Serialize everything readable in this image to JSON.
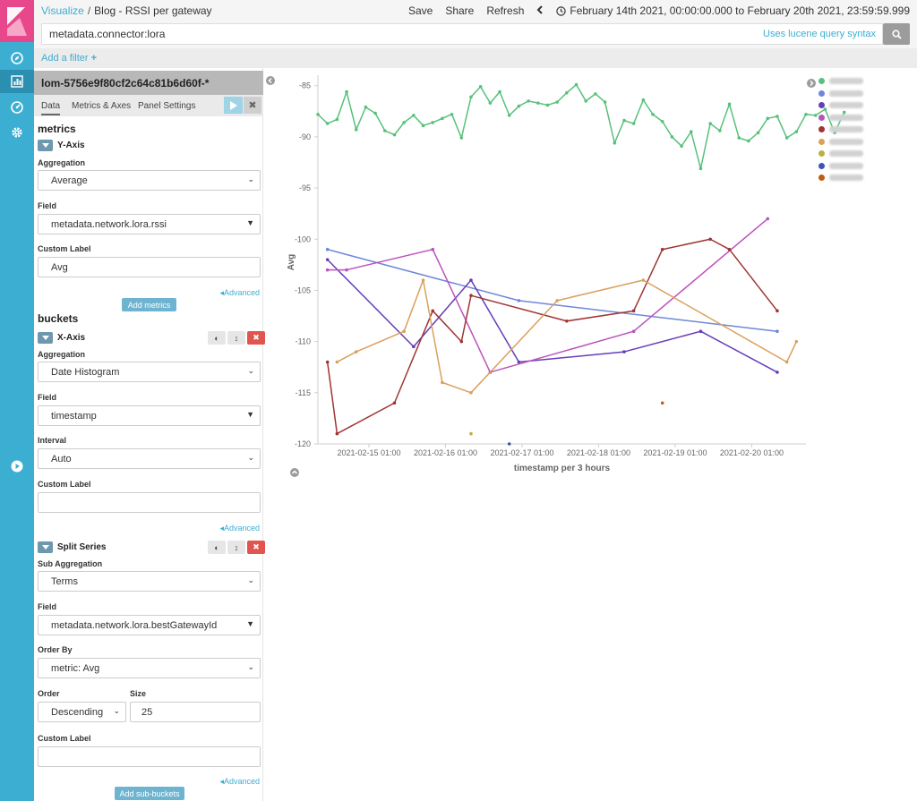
{
  "breadcrumb": {
    "root": "Visualize",
    "separator": "/",
    "current": "Blog - RSSI per gateway"
  },
  "topmenu": {
    "save": "Save",
    "share": "Share",
    "refresh": "Refresh",
    "time_range": "February 14th 2021, 00:00:00.000 to February 20th 2021, 23:59:59.999"
  },
  "query": {
    "value": "metadata.connector:lora",
    "syntax_link": "Uses lucene query syntax"
  },
  "filters": {
    "add_label": "Add a filter"
  },
  "editor": {
    "index_pattern": "lom-5756e9f80cf2c64c81b6d60f-*",
    "tabs": [
      "Data",
      "Metrics & Axes",
      "Panel Settings"
    ],
    "metrics_title": "metrics",
    "y_axis": {
      "title": "Y-Axis",
      "aggregation_label": "Aggregation",
      "aggregation": "Average",
      "field_label": "Field",
      "field": "metadata.network.lora.rssi",
      "custom_label_label": "Custom Label",
      "custom_label": "Avg",
      "advanced": "Advanced"
    },
    "add_metrics": "Add metrics",
    "buckets_title": "buckets",
    "x_axis": {
      "title": "X-Axis",
      "aggregation_label": "Aggregation",
      "aggregation": "Date Histogram",
      "field_label": "Field",
      "field": "timestamp",
      "interval_label": "Interval",
      "interval": "Auto",
      "custom_label_label": "Custom Label",
      "custom_label": "",
      "advanced": "Advanced"
    },
    "split_series": {
      "title": "Split Series",
      "sub_agg_label": "Sub Aggregation",
      "sub_agg": "Terms",
      "field_label": "Field",
      "field": "metadata.network.lora.bestGatewayId",
      "order_by_label": "Order By",
      "order_by": "metric: Avg",
      "order_label": "Order",
      "order": "Descending",
      "size_label": "Size",
      "size": "25",
      "custom_label_label": "Custom Label",
      "custom_label": "",
      "advanced": "Advanced"
    },
    "add_sub_buckets": "Add sub-buckets"
  },
  "chart_data": {
    "type": "line",
    "xlabel": "timestamp per 3 hours",
    "ylabel": "Avg",
    "xlim": [
      "2021-02-14T09:00",
      "2021-02-20T18:00"
    ],
    "ylim": [
      -120,
      -84.5
    ],
    "yticks": [
      -85,
      -90,
      -95,
      -100,
      -105,
      -110,
      -115,
      -120
    ],
    "xticks": [
      "2021-02-15 01:00",
      "2021-02-16 01:00",
      "2021-02-17 01:00",
      "2021-02-18 01:00",
      "2021-02-19 01:00",
      "2021-02-20 01:00"
    ],
    "series": [
      {
        "color": "#57c17b",
        "points": [
          [
            "2021-02-14T09:00",
            -87.8
          ],
          [
            "2021-02-14T12:00",
            -88.7
          ],
          [
            "2021-02-14T15:00",
            -88.3
          ],
          [
            "2021-02-14T18:00",
            -85.6
          ],
          [
            "2021-02-14T21:00",
            -89.3
          ],
          [
            "2021-02-15T00:00",
            -87.1
          ],
          [
            "2021-02-15T03:00",
            -87.7
          ],
          [
            "2021-02-15T06:00",
            -89.4
          ],
          [
            "2021-02-15T09:00",
            -89.8
          ],
          [
            "2021-02-15T12:00",
            -88.6
          ],
          [
            "2021-02-15T15:00",
            -87.9
          ],
          [
            "2021-02-15T18:00",
            -88.9
          ],
          [
            "2021-02-15T21:00",
            -88.6
          ],
          [
            "2021-02-16T00:00",
            -88.2
          ],
          [
            "2021-02-16T03:00",
            -87.8
          ],
          [
            "2021-02-16T06:00",
            -90.1
          ],
          [
            "2021-02-16T09:00",
            -86.1
          ],
          [
            "2021-02-16T12:00",
            -85.1
          ],
          [
            "2021-02-16T15:00",
            -86.7
          ],
          [
            "2021-02-16T18:00",
            -85.6
          ],
          [
            "2021-02-16T21:00",
            -87.9
          ],
          [
            "2021-02-17T00:00",
            -87.0
          ],
          [
            "2021-02-17T03:00",
            -86.5
          ],
          [
            "2021-02-17T06:00",
            -86.7
          ],
          [
            "2021-02-17T09:00",
            -86.9
          ],
          [
            "2021-02-17T12:00",
            -86.6
          ],
          [
            "2021-02-17T15:00",
            -85.7
          ],
          [
            "2021-02-17T18:00",
            -84.9
          ],
          [
            "2021-02-17T21:00",
            -86.5
          ],
          [
            "2021-02-18T00:00",
            -85.8
          ],
          [
            "2021-02-18T03:00",
            -86.6
          ],
          [
            "2021-02-18T06:00",
            -90.6
          ],
          [
            "2021-02-18T09:00",
            -88.4
          ],
          [
            "2021-02-18T12:00",
            -88.7
          ],
          [
            "2021-02-18T15:00",
            -86.4
          ],
          [
            "2021-02-18T18:00",
            -87.8
          ],
          [
            "2021-02-18T21:00",
            -88.5
          ],
          [
            "2021-02-19T00:00",
            -90.0
          ],
          [
            "2021-02-19T03:00",
            -90.9
          ],
          [
            "2021-02-19T06:00",
            -89.5
          ],
          [
            "2021-02-19T09:00",
            -93.1
          ],
          [
            "2021-02-19T12:00",
            -88.7
          ],
          [
            "2021-02-19T15:00",
            -89.4
          ],
          [
            "2021-02-19T18:00",
            -86.8
          ],
          [
            "2021-02-19T21:00",
            -90.1
          ],
          [
            "2021-02-20T00:00",
            -90.4
          ],
          [
            "2021-02-20T03:00",
            -89.6
          ],
          [
            "2021-02-20T06:00",
            -88.2
          ],
          [
            "2021-02-20T09:00",
            -88.0
          ],
          [
            "2021-02-20T12:00",
            -90.1
          ],
          [
            "2021-02-20T15:00",
            -89.5
          ],
          [
            "2021-02-20T18:00",
            -87.8
          ],
          [
            "2021-02-20T21:00",
            -87.9
          ],
          [
            "2021-02-21T00:00",
            -87.3
          ],
          [
            "2021-02-21T03:00",
            -89.6
          ],
          [
            "2021-02-21T06:00",
            -87.6
          ]
        ]
      },
      {
        "color": "#6f87d8",
        "points": [
          [
            "2021-02-14T12:00",
            -101
          ],
          [
            "2021-02-17T00:00",
            -106
          ],
          [
            "2021-02-20T09:00",
            -109
          ]
        ]
      },
      {
        "color": "#663db8",
        "points": [
          [
            "2021-02-14T12:00",
            -102
          ],
          [
            "2021-02-15T15:00",
            -110.5
          ],
          [
            "2021-02-16T09:00",
            -104
          ],
          [
            "2021-02-17T00:00",
            -112
          ],
          [
            "2021-02-18T09:00",
            -111
          ],
          [
            "2021-02-19T09:00",
            -109
          ],
          [
            "2021-02-20T09:00",
            -113
          ]
        ]
      },
      {
        "color": "#bc52bc",
        "points": [
          [
            "2021-02-14T12:00",
            -103
          ],
          [
            "2021-02-14T18:00",
            -103
          ],
          [
            "2021-02-15T21:00",
            -101
          ],
          [
            "2021-02-16T15:00",
            -113
          ],
          [
            "2021-02-18T12:00",
            -109
          ],
          [
            "2021-02-20T06:00",
            -98
          ]
        ]
      },
      {
        "color": "#9e3533",
        "points": [
          [
            "2021-02-14T12:00",
            -112
          ],
          [
            "2021-02-14T15:00",
            -119
          ],
          [
            "2021-02-15T09:00",
            -116
          ],
          [
            "2021-02-15T21:00",
            -107
          ],
          [
            "2021-02-16T06:00",
            -110
          ],
          [
            "2021-02-16T09:00",
            -105.5
          ],
          [
            "2021-02-17T15:00",
            -108
          ],
          [
            "2021-02-18T12:00",
            -107
          ],
          [
            "2021-02-18T21:00",
            -101
          ],
          [
            "2021-02-19T12:00",
            -100
          ],
          [
            "2021-02-19T18:00",
            -101
          ],
          [
            "2021-02-20T09:00",
            -107
          ]
        ]
      },
      {
        "color": "#daa05d",
        "points": [
          [
            "2021-02-14T15:00",
            -112
          ],
          [
            "2021-02-14T21:00",
            -111
          ],
          [
            "2021-02-15T12:00",
            -109
          ],
          [
            "2021-02-15T18:00",
            -104
          ],
          [
            "2021-02-16T00:00",
            -114
          ],
          [
            "2021-02-16T09:00",
            -115
          ],
          [
            "2021-02-17T12:00",
            -106
          ],
          [
            "2021-02-18T15:00",
            -104
          ],
          [
            "2021-02-20T12:00",
            -112
          ],
          [
            "2021-02-20T15:00",
            -110
          ]
        ]
      },
      {
        "color": "#bfaf40",
        "points": [
          [
            "2021-02-16T09:00",
            -119
          ]
        ]
      },
      {
        "color": "#4050bf",
        "points": [
          [
            "2021-02-16T21:00",
            -120
          ]
        ]
      },
      {
        "color": "#c15c17",
        "points": [
          [
            "2021-02-18T21:00",
            -116
          ]
        ]
      }
    ]
  },
  "legend_colors": [
    "#57c17b",
    "#6f87d8",
    "#663db8",
    "#bc52bc",
    "#9e3533",
    "#daa05d",
    "#bfaf40",
    "#4050bf",
    "#c15c17"
  ]
}
